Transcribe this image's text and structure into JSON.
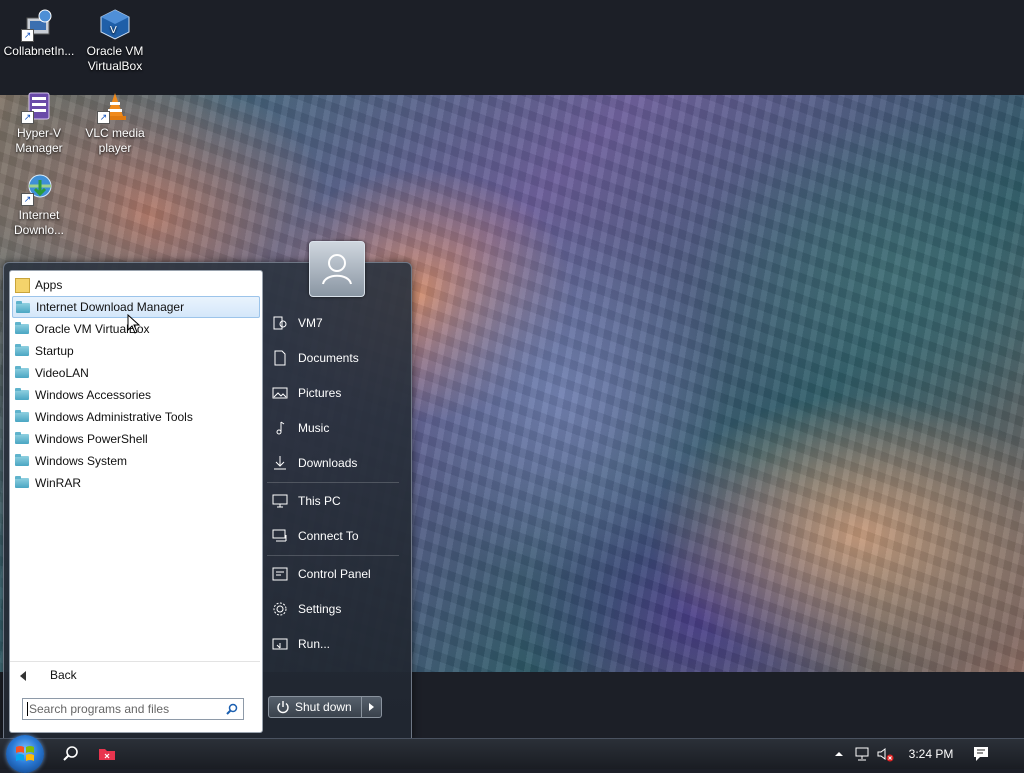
{
  "desktop": {
    "icons": [
      {
        "label": "CollabnetIn..."
      },
      {
        "label": "Oracle VM VirtualBox"
      },
      {
        "label": "Hyper-V Manager"
      },
      {
        "label": "VLC media player"
      },
      {
        "label": "Internet Downlo..."
      }
    ]
  },
  "start_menu": {
    "programs": [
      {
        "label": "Apps"
      },
      {
        "label": "Internet Download Manager"
      },
      {
        "label": "Oracle VM VirtualBox"
      },
      {
        "label": "Startup"
      },
      {
        "label": "VideoLAN"
      },
      {
        "label": "Windows Accessories"
      },
      {
        "label": "Windows Administrative Tools"
      },
      {
        "label": "Windows PowerShell"
      },
      {
        "label": "Windows System"
      },
      {
        "label": "WinRAR"
      }
    ],
    "back_label": "Back",
    "search_placeholder": "Search programs and files",
    "right_items": [
      {
        "label": "VM7"
      },
      {
        "label": "Documents"
      },
      {
        "label": "Pictures"
      },
      {
        "label": "Music"
      },
      {
        "label": "Downloads"
      },
      {
        "label": "This PC"
      },
      {
        "label": "Connect To"
      },
      {
        "label": "Control Panel"
      },
      {
        "label": "Settings"
      },
      {
        "label": "Run..."
      }
    ],
    "shutdown_label": "Shut down"
  },
  "taskbar": {
    "clock": "3:24 PM"
  },
  "colors": {
    "taskbar": "#1a1d23",
    "hover_highlight": "#d4e7fa",
    "folder": "#4aa6c2"
  }
}
